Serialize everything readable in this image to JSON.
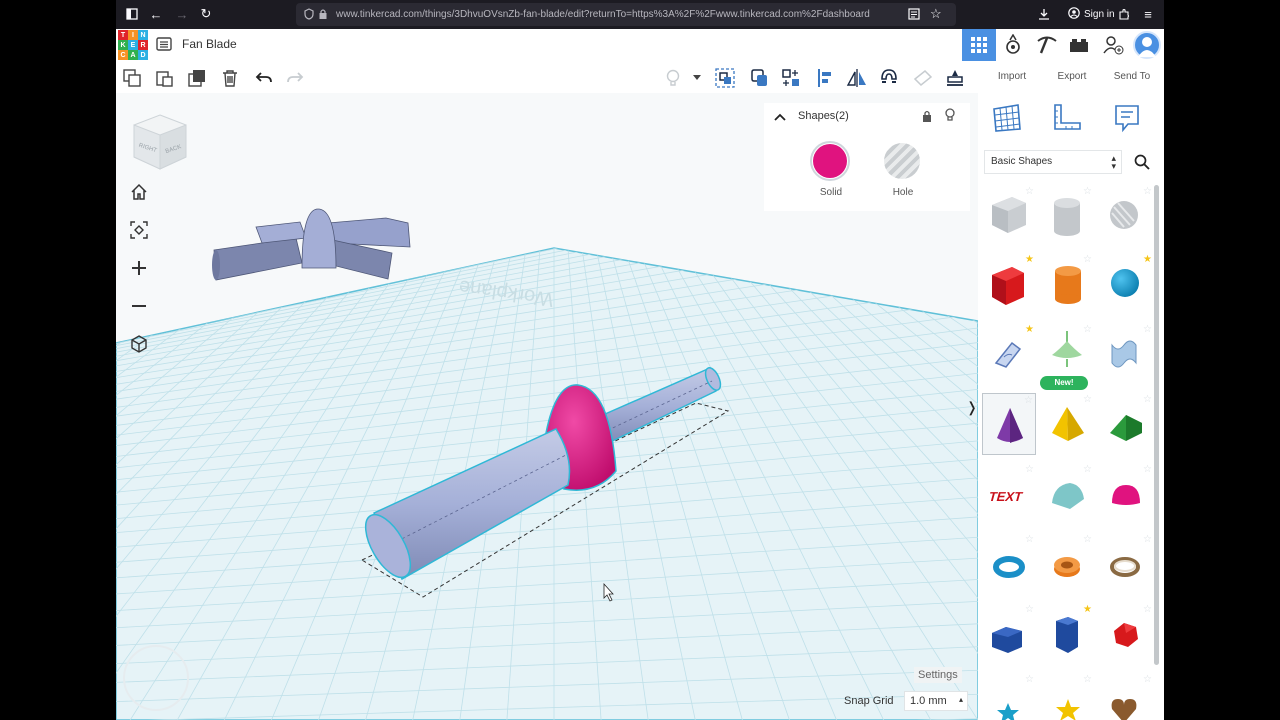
{
  "browser": {
    "url": "www.tinkercad.com/things/3DhvuOVsnZb-fan-blade/edit?returnTo=https%3A%2F%2Fwww.tinkercad.com%2Fdashboard",
    "sign_in_label": "Sign in"
  },
  "app": {
    "logo_letters": [
      "T",
      "I",
      "N",
      "K",
      "E",
      "R",
      "C",
      "A",
      "D"
    ],
    "design_title": "Fan Blade"
  },
  "toolbar": {
    "import_label": "Import",
    "export_label": "Export",
    "send_to_label": "Send To"
  },
  "inspector": {
    "title": "Shapes(2)",
    "solid_label": "Solid",
    "hole_label": "Hole",
    "solid_color": "#e0137f"
  },
  "workspace": {
    "workplane_label": "Workplane",
    "settings_label": "Settings",
    "snap_grid_label": "Snap Grid",
    "snap_grid_value": "1.0 mm",
    "viewcube_faces": [
      "RIGHT",
      "BACK"
    ]
  },
  "shapes_panel": {
    "category": "Basic Shapes",
    "new_badge": "New!",
    "shapes": [
      "box-hole",
      "cylinder-hole",
      "sphere-hole",
      "box",
      "cylinder",
      "sphere",
      "scribble",
      "spinner",
      "text-wave",
      "cone",
      "pyramid",
      "roof",
      "text",
      "half-sphere",
      "paraboloid",
      "torus",
      "tube",
      "ring",
      "polygon",
      "prism",
      "icosahedron",
      "star",
      "star-yellow",
      "heart"
    ]
  },
  "colors": {
    "accent": "#4a90e2",
    "shape_body": "#9aa6cf",
    "magenta": "#e0137f",
    "grid_line": "#bfe4ec"
  }
}
